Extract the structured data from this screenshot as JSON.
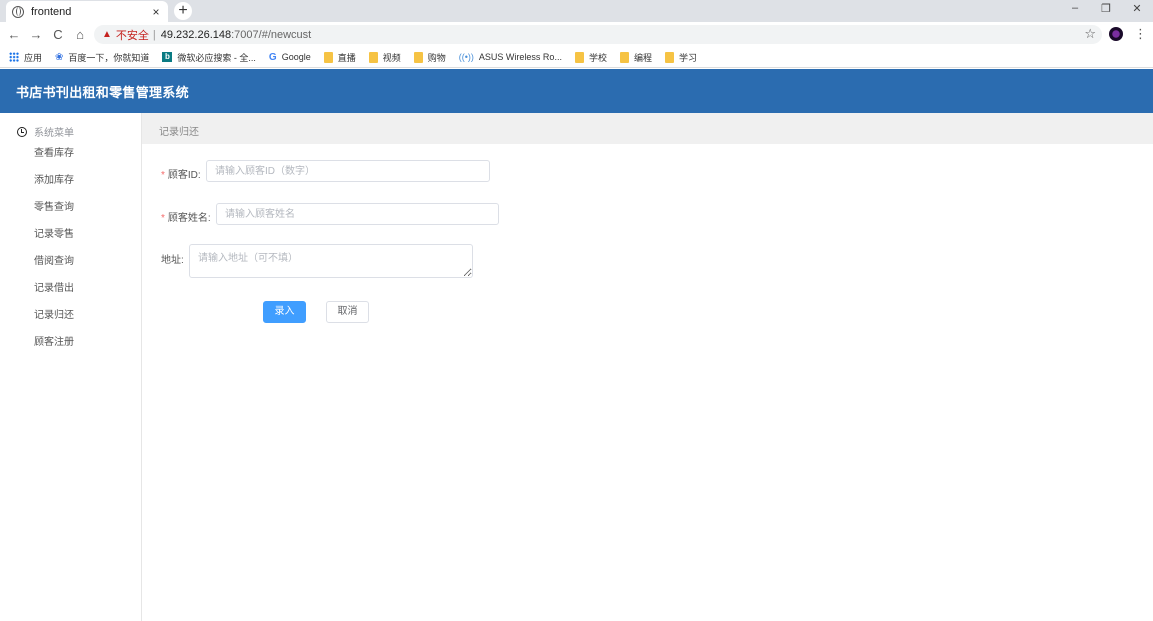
{
  "browser": {
    "tab_title": "frontend",
    "tab_close": "×",
    "newtab": "+",
    "window_controls": [
      "–",
      "❐",
      "✕"
    ],
    "nav": [
      "←",
      "→",
      "C",
      "⌂"
    ],
    "security_label": "不安全",
    "url_separator": "|",
    "url_host": "49.232.26.148",
    "url_rest": ":7007/#/newcust",
    "star": "☆",
    "menu": "⋮",
    "bookmarks": [
      {
        "icon": "apps-icon",
        "label": "应用"
      },
      {
        "icon": "baidu-paw-icon",
        "label": "百度一下，你就知道"
      },
      {
        "icon": "bing-icon",
        "label": "微软必应搜索 - 全..."
      },
      {
        "icon": "google-icon",
        "label": "Google"
      },
      {
        "icon": "folder-icon",
        "label": "直播"
      },
      {
        "icon": "folder-icon",
        "label": "视频"
      },
      {
        "icon": "folder-icon",
        "label": "购物"
      },
      {
        "icon": "wifi-icon",
        "label": "ASUS Wireless Ro..."
      },
      {
        "icon": "folder-icon",
        "label": "学校"
      },
      {
        "icon": "folder-icon",
        "label": "编程"
      },
      {
        "icon": "folder-icon",
        "label": "学习"
      }
    ]
  },
  "app": {
    "title": "书店书刊出租和零售管理系统",
    "header_color": "#2b6cb0"
  },
  "sidebar": {
    "heading": "系统菜单",
    "items": [
      "查看库存",
      "添加库存",
      "零售查询",
      "记录零售",
      "借阅查询",
      "记录借出",
      "记录归还",
      "顾客注册"
    ]
  },
  "main": {
    "breadcrumb": "记录归还",
    "form": {
      "customer_id": {
        "label": "顾客ID",
        "required_mark": "*",
        "colon": ":",
        "placeholder": "请输入顾客ID（数字）",
        "value": ""
      },
      "customer_name": {
        "label": "顾客姓名",
        "required_mark": "*",
        "colon": ":",
        "placeholder": "请输入顾客姓名",
        "value": ""
      },
      "address": {
        "label": "地址",
        "colon": ":",
        "placeholder": "请输入地址（可不填）",
        "value": ""
      },
      "submit_label": "录入",
      "cancel_label": "取消"
    }
  }
}
